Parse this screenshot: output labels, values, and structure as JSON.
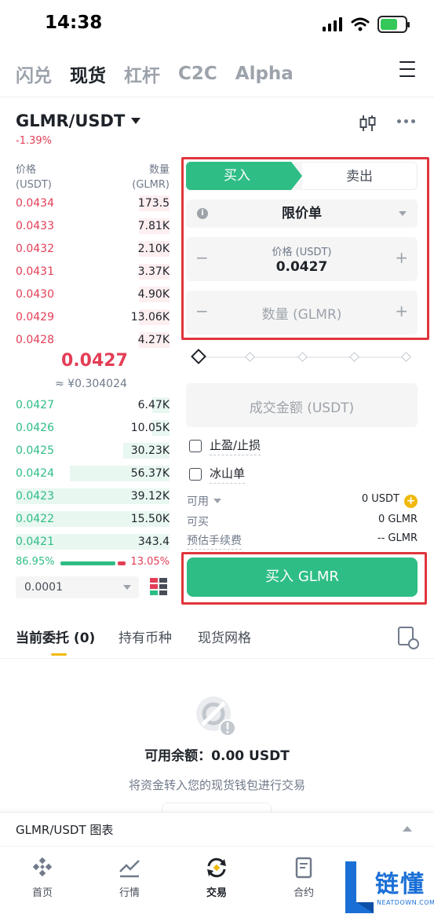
{
  "status_bar": {
    "time": "14:38"
  },
  "top_nav": {
    "tabs": [
      {
        "label": "闪兑",
        "active": false
      },
      {
        "label": "现货",
        "active": true
      },
      {
        "label": "杠杆",
        "active": false
      },
      {
        "label": "C2C",
        "active": false
      },
      {
        "label": "Alpha",
        "active": false
      }
    ]
  },
  "pair": {
    "symbol": "GLMR/USDT",
    "change": "-1.39%"
  },
  "order_book": {
    "price_header": "价格",
    "price_unit": "(USDT)",
    "qty_header": "数量",
    "qty_unit": "(GLMR)",
    "asks": [
      {
        "price": "0.0434",
        "qty": "173.5",
        "depth": 0.2
      },
      {
        "price": "0.0433",
        "qty": "7.81K",
        "depth": 0.2
      },
      {
        "price": "0.0432",
        "qty": "2.10K",
        "depth": 0.2
      },
      {
        "price": "0.0431",
        "qty": "3.37K",
        "depth": 0.2
      },
      {
        "price": "0.0430",
        "qty": "4.90K",
        "depth": 0.2
      },
      {
        "price": "0.0429",
        "qty": "13.06K",
        "depth": 0.2
      },
      {
        "price": "0.0428",
        "qty": "4.27K",
        "depth": 0.2
      }
    ],
    "last_price": "0.0427",
    "last_price_cny": "≈ ¥0.304024",
    "bids": [
      {
        "price": "0.0427",
        "qty": "6.47K",
        "depth": 0.11
      },
      {
        "price": "0.0426",
        "qty": "10.05K",
        "depth": 0.11
      },
      {
        "price": "0.0425",
        "qty": "30.23K",
        "depth": 0.3
      },
      {
        "price": "0.0424",
        "qty": "56.37K",
        "depth": 0.65
      },
      {
        "price": "0.0423",
        "qty": "39.12K",
        "depth": 1.0
      },
      {
        "price": "0.0422",
        "qty": "15.50K",
        "depth": 1.0
      },
      {
        "price": "0.0421",
        "qty": "343.4",
        "depth": 1.0
      }
    ],
    "buy_ratio": "86.95%",
    "sell_ratio": "13.05%",
    "precision": "0.0001"
  },
  "trade": {
    "buy_tab": "买入",
    "sell_tab": "卖出",
    "order_type": "限价单",
    "price_label": "价格 (USDT)",
    "price_value": "0.0427",
    "qty_placeholder": "数量 (GLMR)",
    "total_placeholder": "成交金额 (USDT)",
    "tp_sl": "止盈/止损",
    "iceberg": "冰山单",
    "available_label": "可用",
    "available_value": "0 USDT",
    "can_buy_label": "可买",
    "can_buy_value": "0 GLMR",
    "fee_label": "预估手续费",
    "fee_value": "-- GLMR",
    "submit": "买入 GLMR"
  },
  "orders": {
    "tabs": [
      {
        "label": "当前委托 (0)",
        "active": true
      },
      {
        "label": "持有币种",
        "active": false
      },
      {
        "label": "现货网格",
        "active": false
      }
    ],
    "balance": "可用余额：0.00 USDT",
    "transfer_hint": "将资金转入您的现货钱包进行交易"
  },
  "chart_bar": {
    "label": "GLMR/USDT 图表"
  },
  "bottom_nav": [
    {
      "label": "首页",
      "icon": "home-icon"
    },
    {
      "label": "行情",
      "icon": "market-icon"
    },
    {
      "label": "交易",
      "icon": "trade-icon",
      "active": true
    },
    {
      "label": "合约",
      "icon": "futures-icon"
    }
  ],
  "watermark": {
    "text": "链懂",
    "sub": "NEATDOWN.COM"
  },
  "colors": {
    "buy": "#2ebd85",
    "sell": "#e33e56",
    "highlight": "#e0353d",
    "accent": "#f0b90b"
  }
}
